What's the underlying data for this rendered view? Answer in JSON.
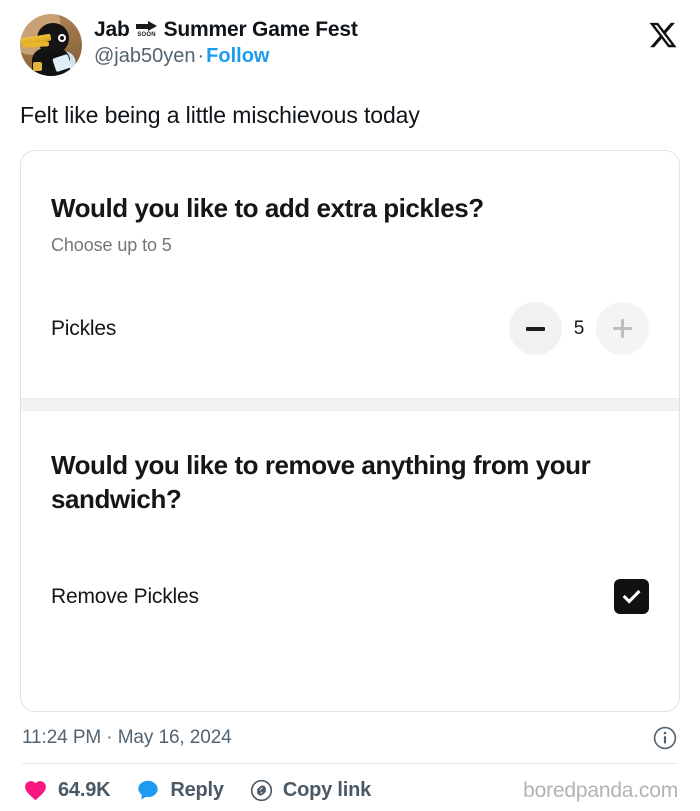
{
  "post": {
    "display_name_prefix": "Jab",
    "emoji_name": "soon-arrow-emoji",
    "emoji_caption": "SOON",
    "display_name_suffix": "Summer Game Fest",
    "handle": "@jab50yen",
    "separator": "·",
    "follow_label": "Follow",
    "text": "Felt like being a little mischievous today",
    "timestamp": "11:24 PM · May 16, 2024",
    "platform_logo": "x-logo"
  },
  "card": {
    "sections": [
      {
        "title": "Would you like to add extra pickles?",
        "subtitle": "Choose up to 5",
        "option_label": "Pickles",
        "stepper": {
          "decrement_label": "−",
          "value": "5",
          "increment_label": "+",
          "max": 5
        }
      },
      {
        "title": "Would you like to remove anything from your sandwich?",
        "option_label": "Remove Pickles",
        "checkbox_checked": true
      }
    ]
  },
  "actions": {
    "like": {
      "icon": "heart-icon",
      "count": "64.9K",
      "color": "#f91880"
    },
    "reply": {
      "icon": "reply-icon",
      "label": "Reply",
      "color": "#1d9bf0"
    },
    "copy_link": {
      "icon": "link-icon",
      "label": "Copy link"
    },
    "info": {
      "icon": "info-icon"
    }
  },
  "watermark": "boredpanda.com",
  "colors": {
    "accent_blue": "#1d9bf0",
    "like_pink": "#f91880",
    "text_primary": "#0f1419",
    "text_secondary": "#536471",
    "card_border": "#dde3e8"
  }
}
